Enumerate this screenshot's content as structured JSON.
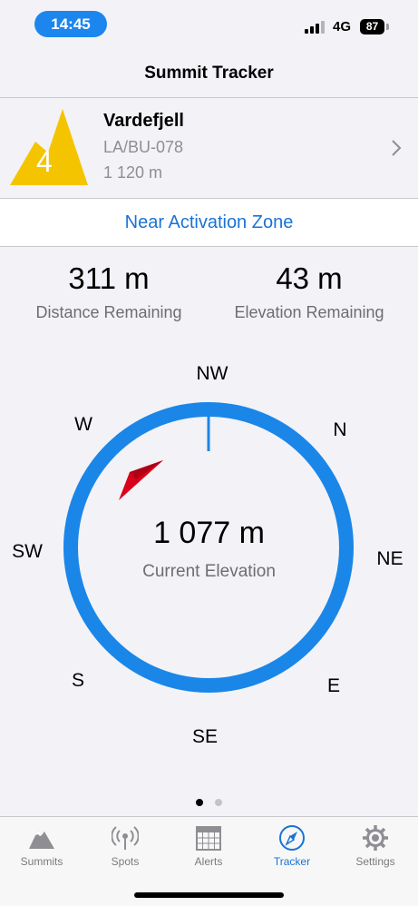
{
  "status_bar": {
    "time": "14:45",
    "network": "4G",
    "battery": "87"
  },
  "nav": {
    "title": "Summit Tracker"
  },
  "summit": {
    "points": "4",
    "name": "Vardefjell",
    "code": "LA/BU-078",
    "altitude": "1 120 m",
    "peak_color": "#f5c400"
  },
  "zone": {
    "label": "Near Activation Zone"
  },
  "stats": {
    "distance": {
      "value": "311 m",
      "label": "Distance Remaining"
    },
    "elevation": {
      "value": "43 m",
      "label": "Elevation Remaining"
    }
  },
  "compass": {
    "directions": [
      "NW",
      "N",
      "NE",
      "E",
      "SE",
      "S",
      "SW",
      "W"
    ],
    "current_elevation": "1 077 m",
    "current_elevation_label": "Current Elevation",
    "ring_color": "#1a86e8",
    "pointer_color": "#d9001b"
  },
  "pager": {
    "count": 2,
    "active": 0
  },
  "tabs": [
    {
      "label": "Summits",
      "icon": "mountain-icon"
    },
    {
      "label": "Spots",
      "icon": "antenna-icon"
    },
    {
      "label": "Alerts",
      "icon": "calendar-icon"
    },
    {
      "label": "Tracker",
      "icon": "compass-icon",
      "active": true
    },
    {
      "label": "Settings",
      "icon": "gear-icon"
    }
  ],
  "accent_color": "#1a73d4"
}
